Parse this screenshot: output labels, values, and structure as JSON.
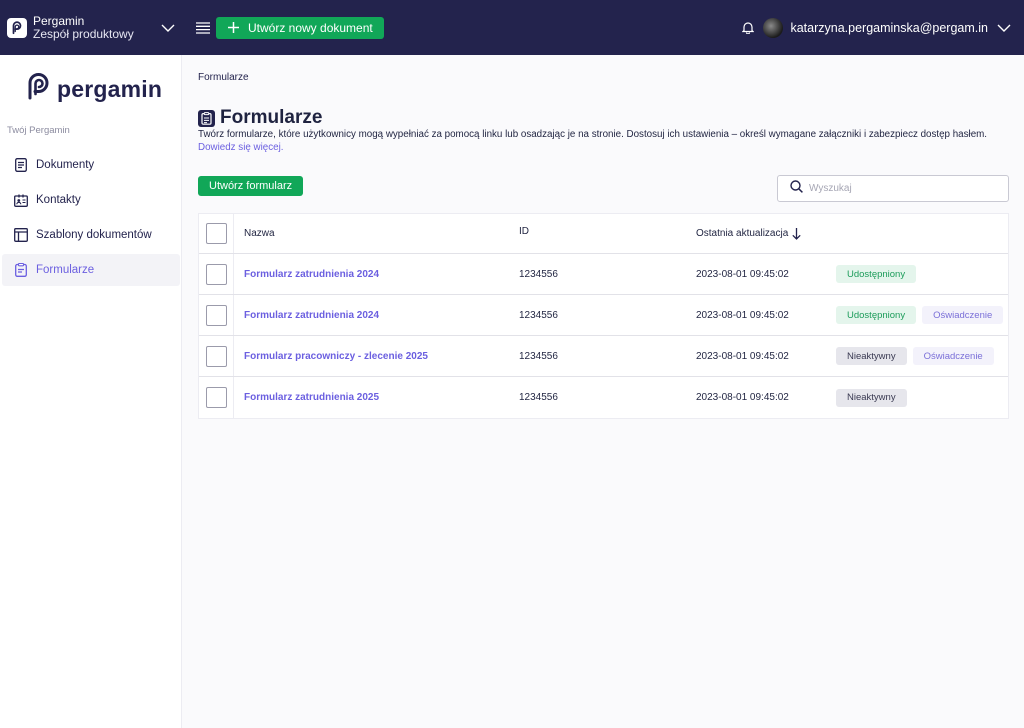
{
  "topbar": {
    "org_name": "Pergamin",
    "org_team": "Zespół produktowy",
    "new_document_label": "Utwórz nowy dokument",
    "user_email": "katarzyna.pergaminska@pergam.in"
  },
  "sidebar": {
    "brand": "pergamin",
    "section_label": "Twój Pergamin",
    "items": [
      {
        "label": "Dokumenty",
        "icon": "document-icon"
      },
      {
        "label": "Kontakty",
        "icon": "contact-card-icon"
      },
      {
        "label": "Szablony dokumentów",
        "icon": "template-icon"
      },
      {
        "label": "Formularze",
        "icon": "clipboard-icon",
        "active": true
      }
    ]
  },
  "main": {
    "breadcrumb": "Formularze",
    "title": "Formularze",
    "description": "Twórz formularze, które użytkownicy mogą wypełniać za pomocą linku lub osadzając je na stronie. Dostosuj ich ustawienia – określ wymagane załączniki i zabezpiecz dostęp hasłem.",
    "learn_more": "Dowiedz się więcej.",
    "create_form_label": "Utwórz formularz",
    "search_placeholder": "Wyszukaj"
  },
  "table": {
    "headers": {
      "name": "Nazwa",
      "id": "ID",
      "updated": "Ostatnia aktualizacja"
    },
    "rows": [
      {
        "name": "Formularz zatrudnienia 2024",
        "id": "1234556",
        "updated": "2023-08-01 09:45:02",
        "tags": [
          {
            "label": "Udostępniony",
            "kind": "shared"
          }
        ]
      },
      {
        "name": "Formularz zatrudnienia 2024",
        "id": "1234556",
        "updated": "2023-08-01 09:45:02",
        "tags": [
          {
            "label": "Udostępniony",
            "kind": "shared"
          },
          {
            "label": "Oświadczenie",
            "kind": "statement"
          }
        ]
      },
      {
        "name": "Formularz pracowniczy - zlecenie 2025",
        "id": "1234556",
        "updated": "2023-08-01 09:45:02",
        "tags": [
          {
            "label": "Nieaktywny",
            "kind": "inactive"
          },
          {
            "label": "Oświadczenie",
            "kind": "statement"
          }
        ]
      },
      {
        "name": "Formularz zatrudnienia 2025",
        "id": "1234556",
        "updated": "2023-08-01 09:45:02",
        "tags": [
          {
            "label": "Nieaktywny",
            "kind": "inactive"
          }
        ]
      }
    ]
  },
  "colors": {
    "topbar": "#23234d",
    "accent_green": "#11a758",
    "link_purple": "#6b5fe0"
  }
}
